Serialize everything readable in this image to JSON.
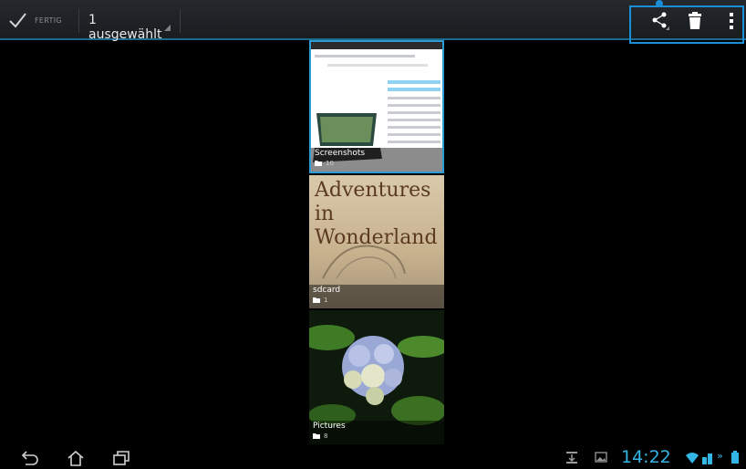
{
  "actionbar": {
    "done_label": "FERTIG",
    "selection_label": "1 ausgewählt",
    "accent_color": "#1b8ed8"
  },
  "albums": [
    {
      "name": "Screenshots",
      "count": "10"
    },
    {
      "name": "sdcard",
      "count": "1",
      "cover_text": "Adventures in Wonderland"
    },
    {
      "name": "Pictures",
      "count": "8"
    }
  ],
  "statusbar": {
    "time": "14:22",
    "clock_color": "#33b5e5"
  },
  "icons": [
    "check-icon",
    "share-icon",
    "trash-icon",
    "overflow-menu-icon",
    "folder-icon",
    "back-icon",
    "home-icon",
    "recent-apps-icon",
    "download-icon",
    "image-icon",
    "wifi-icon",
    "signal-icon",
    "battery-icon"
  ]
}
